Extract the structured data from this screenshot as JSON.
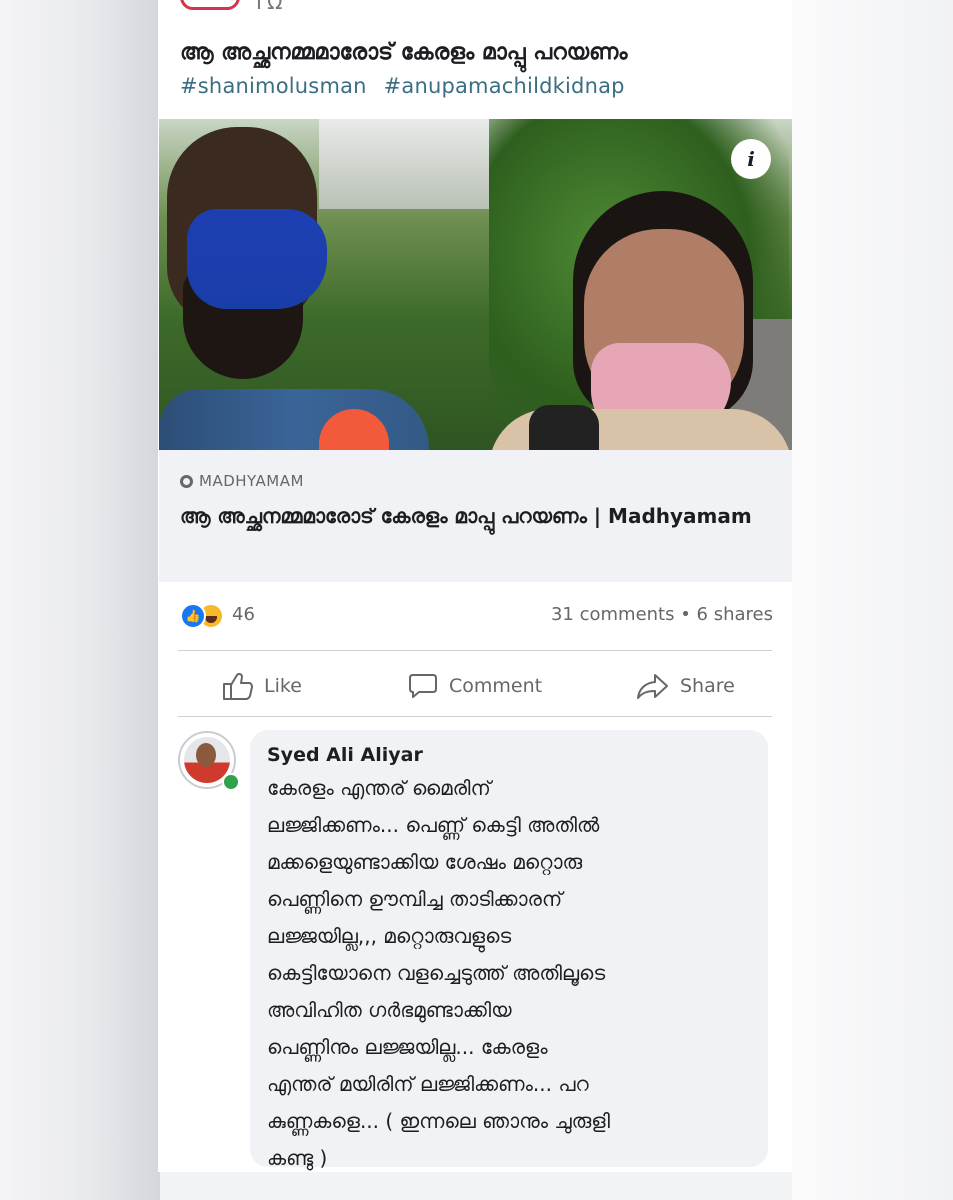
{
  "top_fragment": "ΓΩ",
  "post": {
    "text": "ആ അച്ഛനമ്മമാരോട് കേരളം മാപ്പു പറയണം",
    "hashtags": [
      "#shanimolusman",
      "#anupamachildkidnap"
    ]
  },
  "photo": {
    "info_icon": "i",
    "colors": {
      "mask_blue": "#1d3fb3",
      "mask_pink": "#e6a6b6",
      "mic": "#f25a3b"
    }
  },
  "link_preview": {
    "source": "MADHYAMAM",
    "title": "ആ അച്ഛനമ്മമാരോട് കേരളം മാപ്പു പറയണം | Madhyamam"
  },
  "reactions": {
    "icons": [
      "like-icon",
      "haha-icon"
    ],
    "count": "46",
    "stats": "31 comments • 6 shares"
  },
  "actions": {
    "like": "Like",
    "comment": "Comment",
    "share": "Share"
  },
  "comment": {
    "author": "Syed Ali Aliyar",
    "text": "കേരളം എന്തര് മൈരിന്\nലജ്ജിക്കണം... പെണ്ണ് കെട്ടി അതിൽ\nമക്കളെയുണ്ടാക്കിയ ശേഷം മറ്റൊരു\nപെണ്ണിനെ ഊമ്പിച്ച താടിക്കാരന്\nലജ്ജയില്ല,,, മറ്റൊരുവളുടെ\nകെട്ടിയോനെ വളച്ചെടുത്ത് അതിലൂടെ\nഅവിഹിത ഗർഭമുണ്ടാക്കിയ\nപെണ്ണിനും ലജ്ജയില്ല...  കേരളം\nഎന്തര് മയിരിന് ലജ്ജിക്കണം... പറ\nകുണ്ണകളെ... ( ഇന്നലെ ഞാനും ചുരുളി\nകണ്ടു )"
  },
  "colors": {
    "facebook_blue": "#1877f2",
    "text_primary": "#1c1e21",
    "text_secondary": "#65676b",
    "hashtag": "#3b6e82",
    "online": "#31a24c"
  }
}
